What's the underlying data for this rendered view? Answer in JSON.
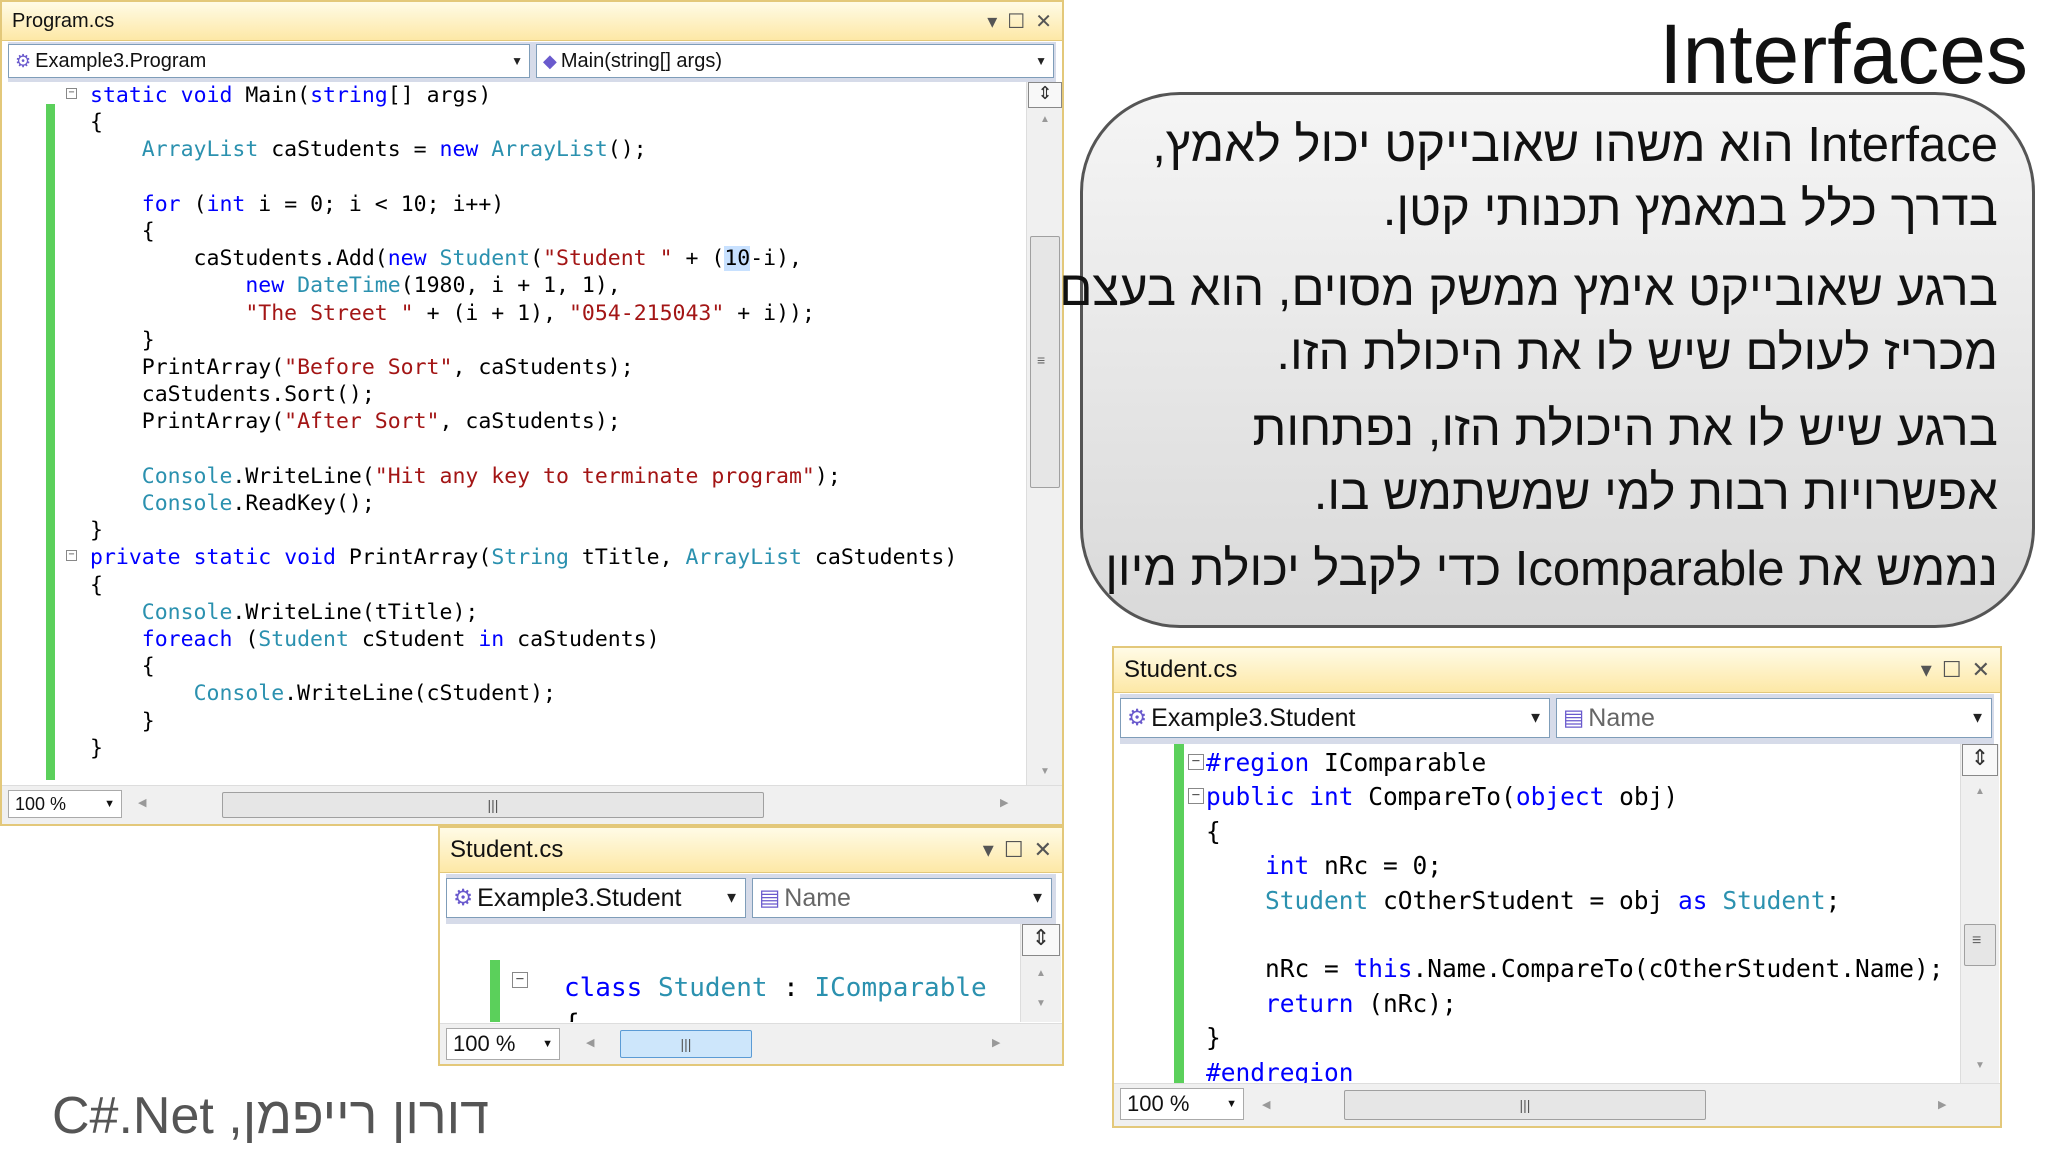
{
  "slide": {
    "title": "Interfaces",
    "bubble_paragraphs": [
      {
        "lines": [
          "Interface הוא משהו שאובייקט יכול לאמץ,",
          "בדרך כלל במאמץ תכנותי קטן."
        ]
      },
      {
        "lines": [
          "ברגע שאובייקט אימץ ממשק מסוים, הוא בעצם",
          "מכריז לעולם שיש לו את היכולת הזו."
        ]
      },
      {
        "lines": [
          "ברגע שיש לו את היכולת הזו, נפתחות",
          "אפשרויות רבות למי שמשתמש בו."
        ]
      },
      {
        "lines": [
          "נממש את Icomparable כדי לקבל יכולת מיון"
        ]
      }
    ],
    "footer": "דורון רייפמן, C#.Net"
  },
  "program_window": {
    "title": "Program.cs",
    "class_combo": "Example3.Program",
    "member_combo": "Main(string[] args)",
    "zoom": "100 %",
    "code_lines": [
      "static void Main(string[] args)",
      "{",
      "    ArrayList caStudents = new ArrayList();",
      "",
      "    for (int i = 0; i < 10; i++)",
      "    {",
      "        caStudents.Add(new Student(\"Student \" + (10-i),",
      "            new DateTime(1980, i + 1, 1),",
      "            \"The Street \" + (i + 1), \"054-215043\" + i));",
      "    }",
      "    PrintArray(\"Before Sort\", caStudents);",
      "    caStudents.Sort();",
      "    PrintArray(\"After Sort\", caStudents);",
      "",
      "    Console.WriteLine(\"Hit any key to terminate program\");",
      "    Console.ReadKey();",
      "}",
      "private static void PrintArray(String tTitle, ArrayList caStudents)",
      "{",
      "    Console.WriteLine(tTitle);",
      "    foreach (Student cStudent in caStudents)",
      "    {",
      "        Console.WriteLine(cStudent);",
      "    }",
      "}"
    ]
  },
  "student_small_window": {
    "title": "Student.cs",
    "class_combo": "Example3.Student",
    "member_combo": "Name",
    "zoom": "100 %",
    "code_lines": [
      "",
      "class Student : IComparable",
      "{"
    ]
  },
  "student_large_window": {
    "title": "Student.cs",
    "class_combo": "Example3.Student",
    "member_combo": "Name",
    "zoom": "100 %",
    "code_lines": [
      "#region IComparable",
      "public int CompareTo(object obj)",
      "{",
      "    int nRc = 0;",
      "    Student cOtherStudent = obj as Student;",
      "",
      "    nRc = this.Name.CompareTo(cOtherStudent.Name);",
      "    return (nRc);",
      "}",
      "#endregion"
    ]
  },
  "icons": {
    "minimize": "▾",
    "maximize": "☐",
    "close": "✕",
    "dropdown": "▼",
    "class_icon": "class-icon",
    "member_icon": "method-icon"
  },
  "colors": {
    "keyword": "#0000ff",
    "type": "#2b91af",
    "string": "#a31515",
    "change_bar": "#5bd05b"
  }
}
